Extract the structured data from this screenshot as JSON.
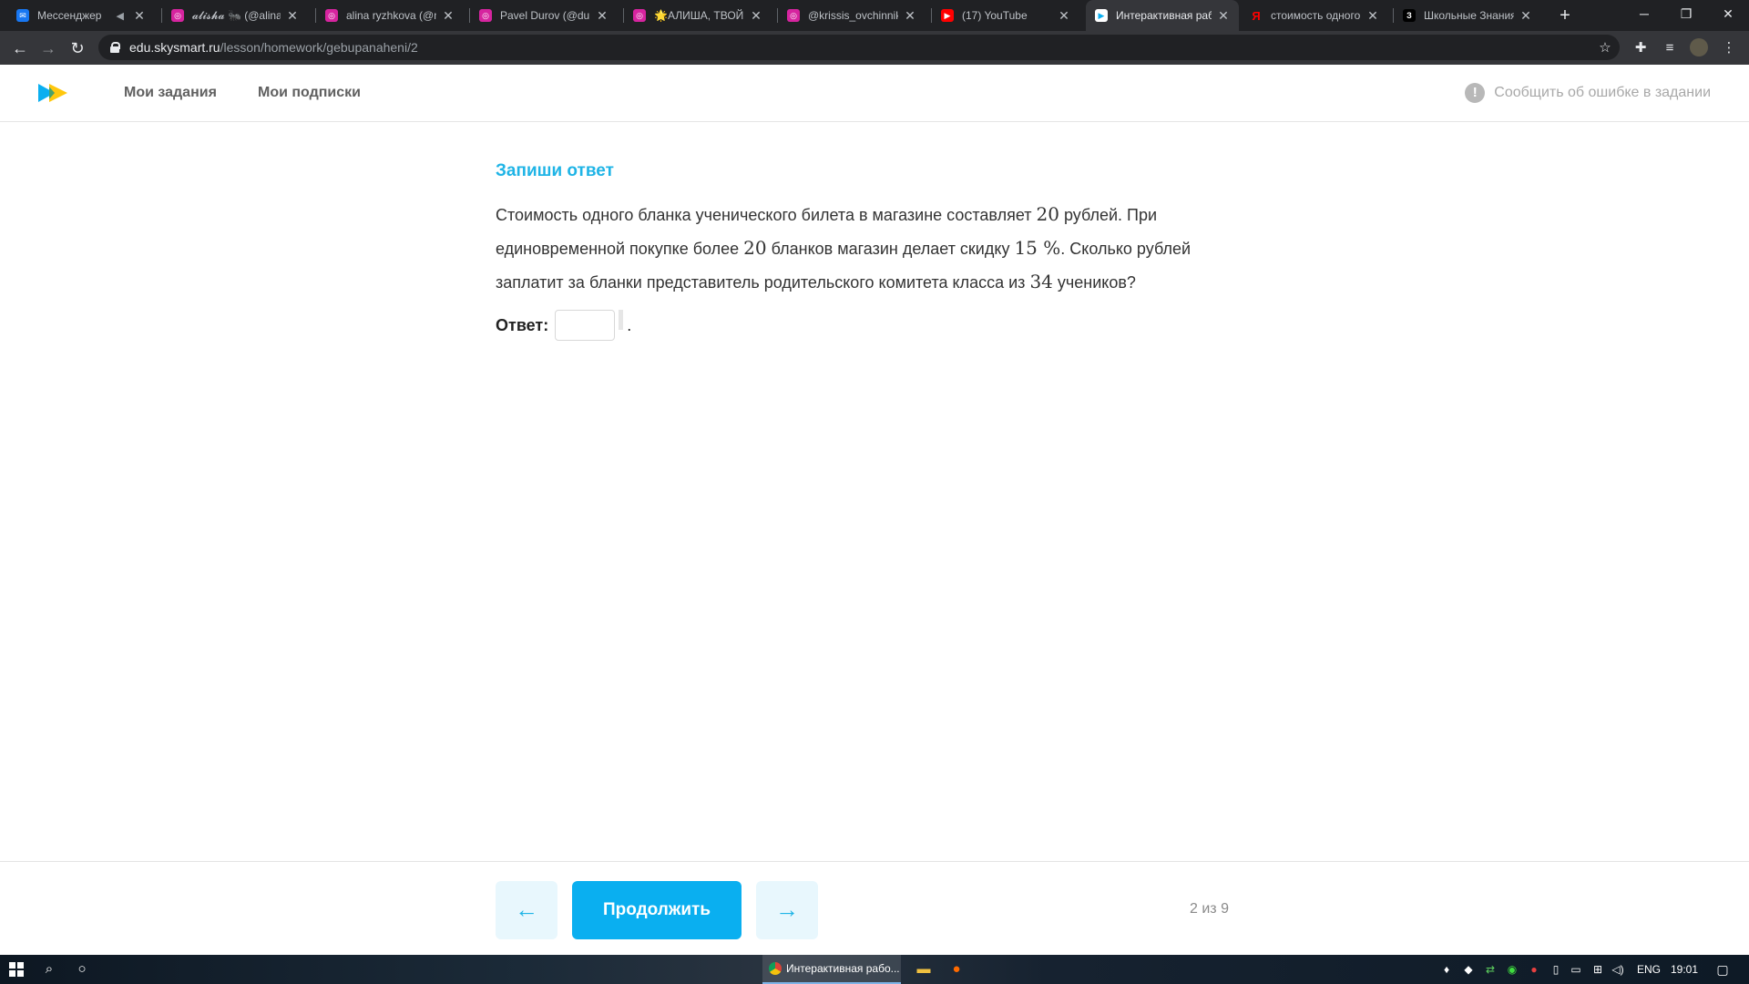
{
  "browser": {
    "tabs": [
      {
        "title": "Мессенджер",
        "favicon": "messenger-icon",
        "color": "#1877f2",
        "muted": true
      },
      {
        "title": "𝓪𝓵𝓲𝓼𝓱𝓪 🐜 (@alina",
        "favicon": "instagram-icon",
        "color": "#d6249f"
      },
      {
        "title": "alina ryzhkova (@m",
        "favicon": "instagram-icon",
        "color": "#d6249f"
      },
      {
        "title": "Pavel Durov (@duro",
        "favicon": "instagram-icon",
        "color": "#d6249f"
      },
      {
        "title": "🌟АЛИША, ТВОЙ I",
        "favicon": "instagram-icon",
        "color": "#d6249f"
      },
      {
        "title": "@krissis_ovchinniko",
        "favicon": "instagram-icon",
        "color": "#d6249f"
      },
      {
        "title": "(17) YouTube",
        "favicon": "youtube-icon",
        "color": "#ff0000"
      },
      {
        "title": "Интерактивная раб",
        "favicon": "skysmart-icon",
        "color": "#ffffff",
        "active": true
      },
      {
        "title": "стоимость одного",
        "favicon": "yandex-icon",
        "color": "#ff0000"
      },
      {
        "title": "Школьные Знания",
        "favicon": "znania-icon",
        "color": "#000000"
      }
    ],
    "url_host": "edu.skysmart.ru",
    "url_path": "/lesson/homework/gebupanaheni/2"
  },
  "header": {
    "nav": [
      "Мои задания",
      "Мои подписки"
    ],
    "report_label": "Сообщить об ошибке в задании",
    "report_icon": "!"
  },
  "task": {
    "title": "Запиши ответ",
    "text_parts": {
      "p1": "Стоимость одного бланка ученического билета в магазине составляет ",
      "n1": "20",
      "p2": " рублей. При единовременной покупке более ",
      "n2": "20",
      "p3": " бланков магазин делает скидку ",
      "n3": "15 %",
      "p4": ". Сколько рублей заплатит за бланки представитель родительского комитета класса из ",
      "n4": "34",
      "p5": " учеников?"
    },
    "answer_label": "Ответ:",
    "answer_value": "",
    "answer_suffix": "."
  },
  "footer": {
    "prev_icon": "←",
    "continue_label": "Продолжить",
    "next_icon": "→",
    "progress": "2 из 9"
  },
  "taskbar": {
    "app_label": "Интерактивная рабо...",
    "lang": "ENG",
    "time": "19:01"
  },
  "colors": {
    "accent": "#0aaff0",
    "title": "#1fb4e6"
  }
}
